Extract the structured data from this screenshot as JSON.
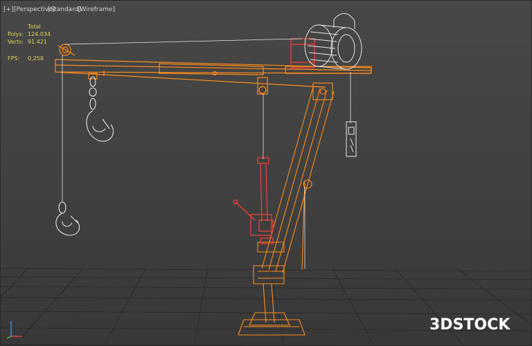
{
  "viewport": {
    "labels": {
      "menu": "[+]",
      "view": "[Perspective]",
      "shading_standard": "[Standard]",
      "shading": "[Wireframe]"
    },
    "stats": {
      "header": "Total",
      "polys_label": "Polys:",
      "polys_value": "124.034",
      "verts_label": "Verts:",
      "verts_value": "91.421",
      "fps_label": "FPS:",
      "fps_value": "0,258"
    }
  },
  "scene": {
    "model": "jib-crane-with-electric-hoist",
    "selected_color": "#ff8c1a",
    "wire_color": "#e6e6e6",
    "accent_color": "#ff3a3a",
    "grid_color": "#2c2c2c"
  },
  "watermark": {
    "text": "3DSTOCK",
    "logo": "3dstock-logo"
  },
  "axis_icon": "xyz-axis-tripod-icon"
}
